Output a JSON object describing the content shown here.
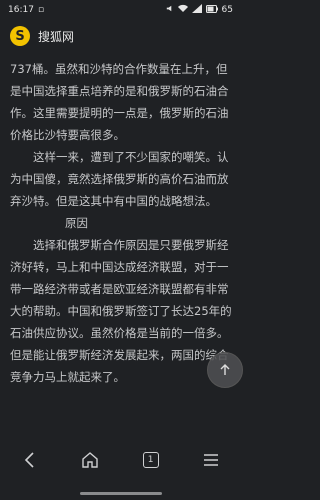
{
  "status_bar": {
    "time": "16:17",
    "battery": "65"
  },
  "header": {
    "logo_text": "S",
    "site_name": "搜狐网"
  },
  "article": {
    "p1": "737桶。虽然和沙特的合作数量在上升，但是中国选择重点培养的是和俄罗斯的石油合作。这里需要提明的一点是，俄罗斯的石油价格比沙特要高很多。",
    "p2": "这样一来，遭到了不少国家的嘲笑。认为中国傻，竟然选择俄罗斯的高价石油而放弃沙特。但是这其中有中国的战略想法。",
    "section_title": "原因",
    "p3": "选择和俄罗斯合作原因是只要俄罗斯经济好转，马上和中国达成经济联盟，对于一带一路经济带或者是欧亚经济联盟都有非常大的帮助。中国和俄罗斯签订了长达25年的石油供应协议。虽然价格是当前的一倍多。但是能让俄罗斯经济发展起来，两国的综合竞争力马上就起来了。"
  },
  "float_button": {
    "icon": "arrow-up"
  },
  "bottom_nav": {
    "tab_count": "1",
    "icons": [
      "back",
      "home",
      "tabs",
      "menu"
    ]
  }
}
